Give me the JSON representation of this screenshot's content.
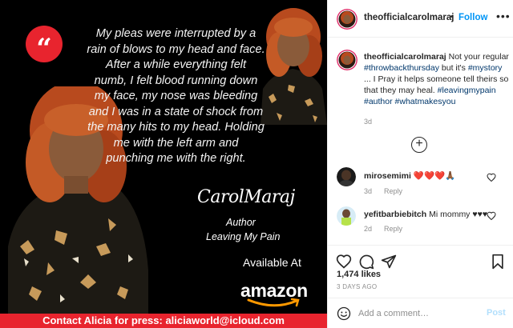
{
  "image": {
    "quote_mark": "“",
    "quote_lines": [
      "My pleas were interrupted by a",
      "rain of blows to my head and face.",
      "After a while everything felt",
      "numb, I felt blood running down",
      "my face, my nose was bleeding",
      "and I was in a state of shock from",
      "the many hits to my head. Holding",
      "me with the left arm and",
      "punching me with the right."
    ],
    "signature": "CarolMaraj",
    "author_role": "Author",
    "book_title": "Leaving My Pain",
    "available_text": "Available At",
    "store_name": "amazon",
    "contact_text": "Contact Alicia for press: aliciaworld@icloud.com",
    "accent_color": "#e8242e"
  },
  "header": {
    "username": "theofficialcarolmaraj",
    "dot": "•",
    "follow_label": "Follow",
    "more_icon": "more-horizontal-icon"
  },
  "caption": {
    "username": "theofficialcarolmaraj",
    "text_1": "Not your regular",
    "tag_1": "#throwbackthursday",
    "text_2": "but it's",
    "tag_2": "#mystory",
    "text_3": "... I Pray it helps someone tell theirs so that they may heal.",
    "tag_3": "#leavingmypain",
    "tag_4": "#author",
    "tag_5": "#whatmakesyou",
    "time": "3d"
  },
  "comments": [
    {
      "username": "mirosemimi",
      "text": "❤️❤️❤️🙏🏾",
      "time": "3d",
      "reply_label": "Reply"
    },
    {
      "username": "yefitbarbiebitch",
      "text": "Mi mommy ♥♥♥",
      "time": "2d",
      "reply_label": "Reply"
    }
  ],
  "actions": {
    "likes": "1,474 likes",
    "date": "3 DAYS AGO"
  },
  "comment_box": {
    "placeholder": "Add a comment…",
    "post_label": "Post"
  },
  "colors": {
    "follow_blue": "#0095f6",
    "hashtag_blue": "#00376b",
    "muted_gray": "#8e8e8e"
  }
}
